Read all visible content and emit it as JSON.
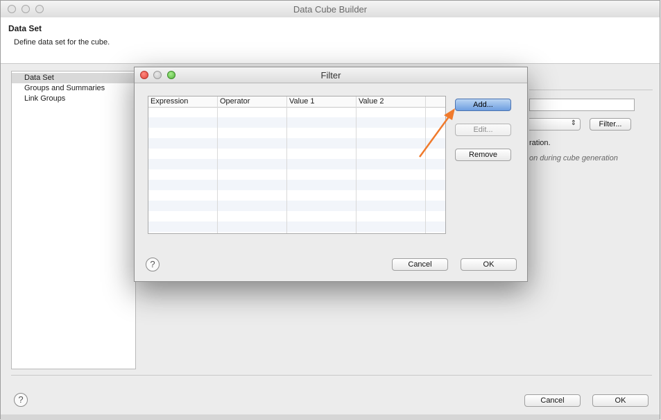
{
  "window": {
    "title": "Data Cube Builder",
    "header_title": "Data Set",
    "header_subtitle": "Define data set for the cube."
  },
  "nav": {
    "items": [
      {
        "label": "Data Set",
        "selected": true
      },
      {
        "label": "Groups and Summaries",
        "selected": false
      },
      {
        "label": "Link Groups",
        "selected": false
      }
    ]
  },
  "background_panel": {
    "filter_button": "Filter...",
    "text_partial_1": "ration.",
    "text_partial_2": "on during cube generation"
  },
  "footer": {
    "cancel_label": "Cancel",
    "ok_label": "OK",
    "help_glyph": "?"
  },
  "filter_dialog": {
    "title": "Filter",
    "columns": [
      "Expression",
      "Operator",
      "Value 1",
      "Value 2"
    ],
    "rows": [],
    "add_label": "Add...",
    "edit_label": "Edit...",
    "remove_label": "Remove",
    "cancel_label": "Cancel",
    "ok_label": "OK",
    "help_glyph": "?"
  },
  "colors": {
    "annotation_arrow": "#f07a2c",
    "primary_button": "#6e9ee0"
  }
}
